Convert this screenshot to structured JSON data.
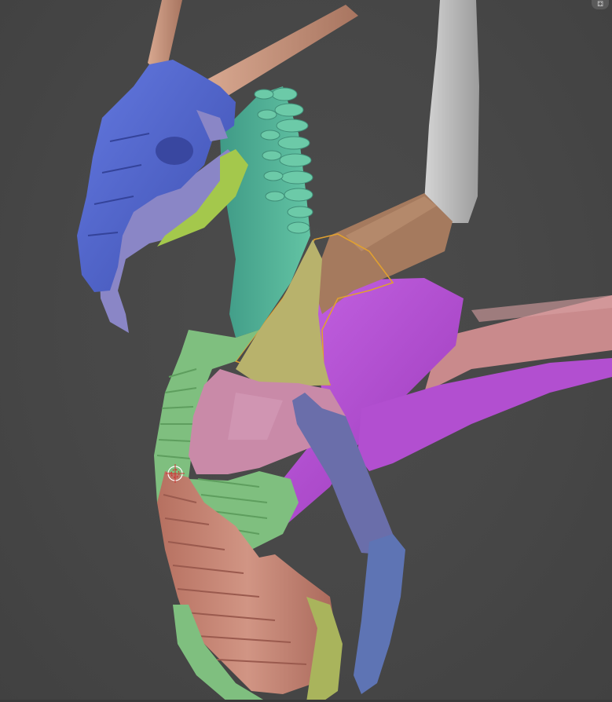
{
  "viewport": {
    "background": "#474747",
    "corner_icon": "floor-grid-icon"
  },
  "model": {
    "description_colors": {
      "skull": "#4f63c8",
      "jaw": "#8a86c6",
      "horn": "#c99a84",
      "neck_spines": "#5fbfa0",
      "neck": "#4aa392",
      "chest_plate": "#b8b26c",
      "shoulder": "#c98aa8",
      "upper_arm": "#6a6eaa",
      "forearm": "#5e74b4",
      "ribcage": "#7fbf7f",
      "belly": "#c98878",
      "wing_membrane": "#b24fd0",
      "wing_bone": "#c98a8c",
      "wing_upper": "#a07458",
      "wing_tip": "#b5b5b5",
      "selection_outline": "#e0a030",
      "leg": "#a9b45c"
    }
  },
  "cursor": {
    "type": "transpose-target-cursor"
  }
}
